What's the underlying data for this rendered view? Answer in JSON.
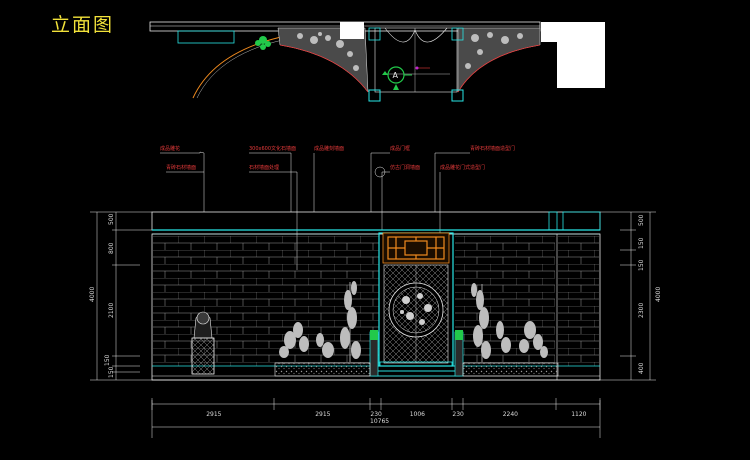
{
  "title": "立面图",
  "section_marker": "A",
  "annotations": [
    {
      "id": "a1",
      "text": "成品雕花"
    },
    {
      "id": "a2",
      "text": "青砖石材墙面"
    },
    {
      "id": "a3",
      "text": "300x600文化石墙面"
    },
    {
      "id": "a4",
      "text": "石材墙面处理"
    },
    {
      "id": "a5",
      "text": "成品雕刻墙面"
    },
    {
      "id": "a6",
      "text": "成品门框"
    },
    {
      "id": "a7",
      "text": "仿古门洞墙面"
    },
    {
      "id": "a8",
      "text": "青砖石材墙面造型门"
    },
    {
      "id": "a9",
      "text": "成品雕花门式造型门"
    }
  ],
  "bottom_dims": [
    "2915",
    "2915",
    "230",
    "1006",
    "230",
    "2240",
    "1120"
  ],
  "total_dim": "10765",
  "left_dims": [
    "500",
    "800",
    "4000",
    "2100",
    "150",
    "150"
  ],
  "right_dims": [
    "500",
    "150",
    "150",
    "2300",
    "400",
    "4000"
  ],
  "colors": {
    "background": "#000000",
    "cyan": "#28e6e6",
    "white": "#e8e8e8",
    "orange": "#f08a1e",
    "red": "#e63a3a",
    "green": "#22c94a",
    "yellow": "#f2e23a"
  }
}
